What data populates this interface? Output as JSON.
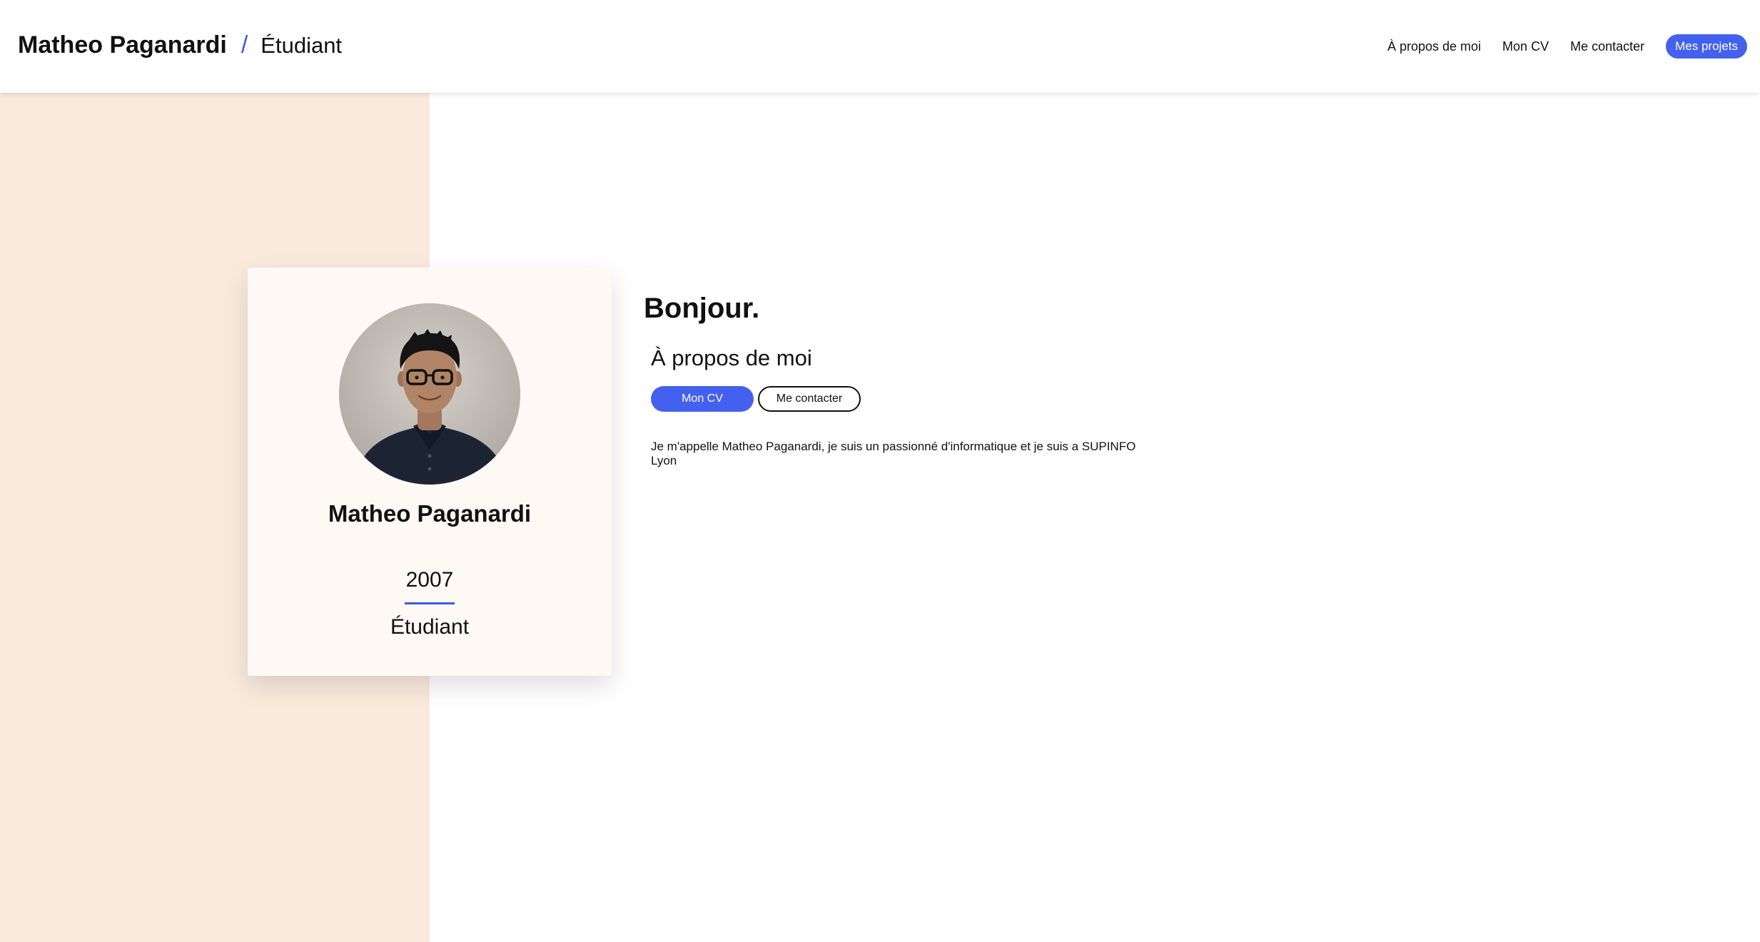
{
  "header": {
    "name": "Matheo Paganardi",
    "separator": "/",
    "role": "Étudiant",
    "nav": {
      "about": "À propos de moi",
      "cv": "Mon CV",
      "contact": "Me contacter",
      "projects": "Mes projets"
    }
  },
  "profile": {
    "name": "Matheo Paganardi",
    "year": "2007",
    "role": "Étudiant",
    "avatar_icon": "portrait-photo"
  },
  "main": {
    "greeting": "Bonjour.",
    "about_title": "À propos de moi",
    "cv_button": "Mon CV",
    "contact_button": "Me contacter",
    "bio": "Je m'appelle Matheo Paganardi, je suis un passionné d'informatique et je suis a SUPINFO Lyon"
  },
  "colors": {
    "accent": "#4361ee",
    "panel": "#f9eadc",
    "card": "#fff9f5"
  }
}
